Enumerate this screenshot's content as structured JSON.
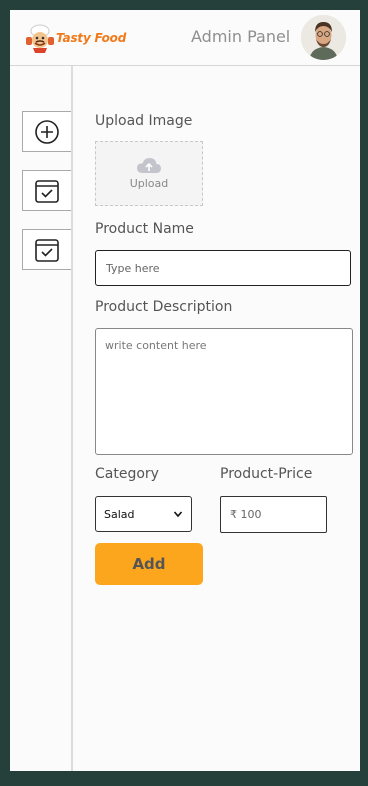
{
  "header": {
    "logo_text": "Tasty Food",
    "title": "Admin Panel",
    "avatar_icon": "user-avatar"
  },
  "sidebar": {
    "items": [
      {
        "icon": "add-circle-icon"
      },
      {
        "icon": "calendar-check-icon"
      },
      {
        "icon": "calendar-check-icon"
      }
    ]
  },
  "form": {
    "upload_label": "Upload Image",
    "upload_button": "Upload",
    "name_label": "Product Name",
    "name_placeholder": "Type here",
    "description_label": "Product Description",
    "description_placeholder": "write content here",
    "category_label": "Category",
    "category_value": "Salad",
    "price_label": "Product-Price",
    "price_placeholder": "₹ 100",
    "add_button": "Add"
  },
  "colors": {
    "accent": "#fba61c",
    "logo": "#f07a1a",
    "page_bg": "#25403b"
  }
}
